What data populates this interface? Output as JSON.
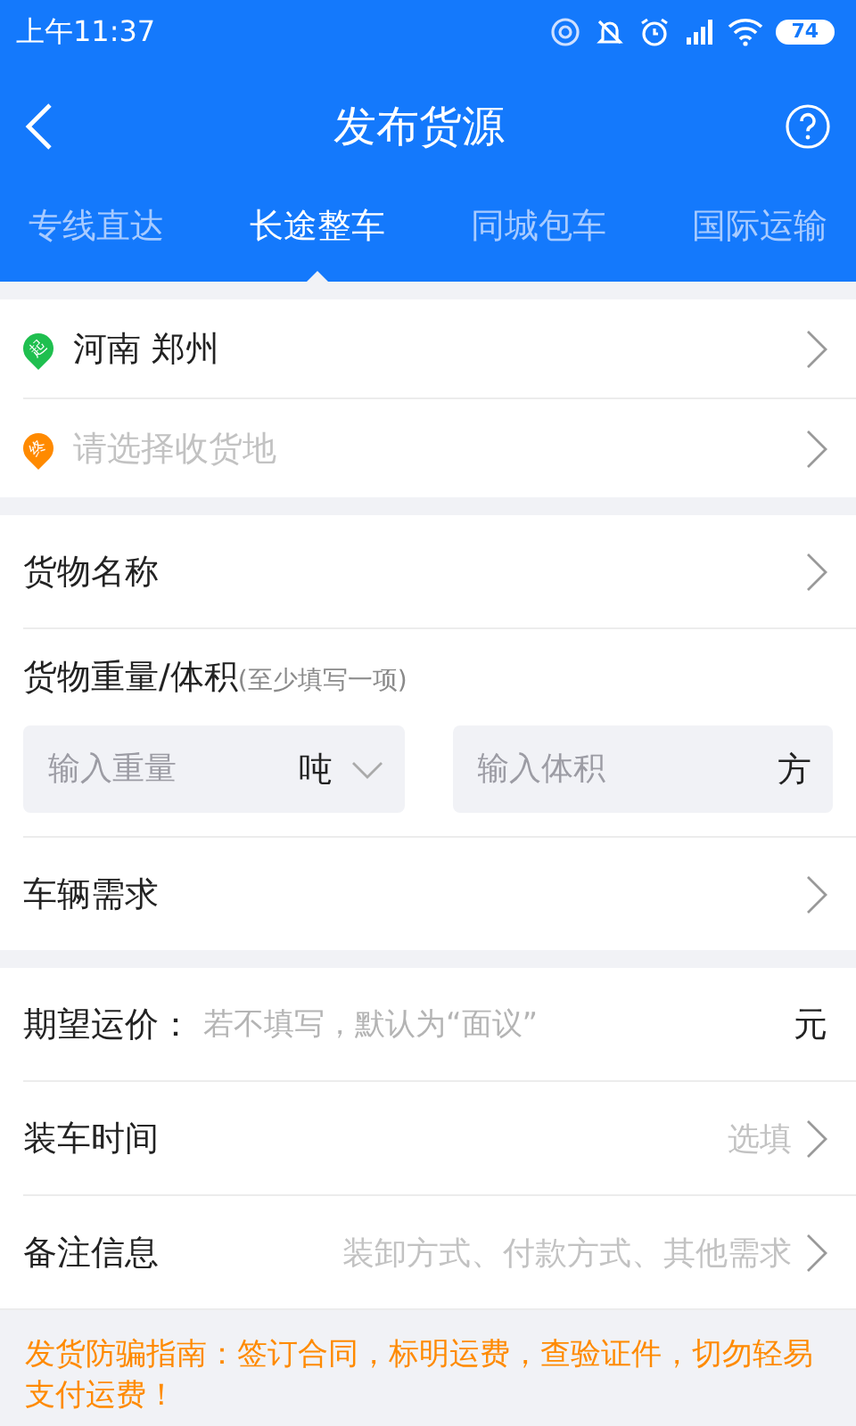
{
  "status_bar": {
    "time": "上午11:37",
    "battery": "74"
  },
  "header": {
    "title": "发布货源"
  },
  "tabs": [
    {
      "label": "专线直达",
      "selected": false
    },
    {
      "label": "长途整车",
      "selected": true
    },
    {
      "label": "同城包车",
      "selected": false
    },
    {
      "label": "国际运输",
      "selected": false
    }
  ],
  "route": [
    {
      "kind": "start",
      "marker": "起",
      "value": "河南 郑州"
    },
    {
      "kind": "end",
      "marker": "终",
      "placeholder": "请选择收货地"
    }
  ],
  "cargo": {
    "name_label": "货物名称",
    "measure_label": "货物重量/体积",
    "measure_hint": "(至少填写一项)",
    "weight": {
      "placeholder": "输入重量",
      "unit": "吨"
    },
    "volume": {
      "placeholder": "输入体积",
      "unit": "方"
    },
    "vehicle_label": "车辆需求"
  },
  "details": {
    "price": {
      "label": "期望运价：",
      "placeholder": "若不填写，默认为“面议”",
      "unit": "元"
    },
    "loading_time": {
      "label": "装车时间",
      "hint": "选填"
    },
    "remarks": {
      "label": "备注信息",
      "hint": "装卸方式、付款方式、其他需求"
    }
  },
  "notice": "发货防骗指南：签订合同，标明运费，查验证件，切勿轻易支付运费！"
}
